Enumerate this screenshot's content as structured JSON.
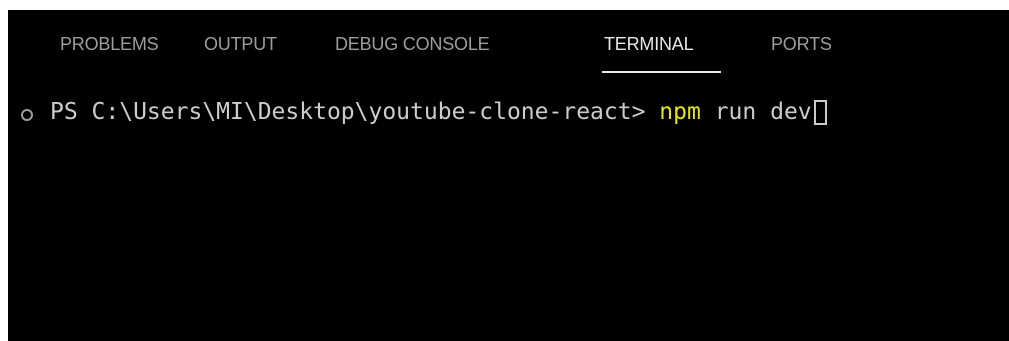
{
  "panel": {
    "tabs": [
      {
        "label": "PROBLEMS",
        "active": false
      },
      {
        "label": "OUTPUT",
        "active": false
      },
      {
        "label": "DEBUG CONSOLE",
        "active": false
      },
      {
        "label": "TERMINAL",
        "active": true
      },
      {
        "label": "PORTS",
        "active": false
      }
    ]
  },
  "terminal": {
    "prompt": "PS C:\\Users\\MI\\Desktop\\youtube-clone-react>",
    "command": "npm",
    "args": "run dev"
  },
  "colors": {
    "background": "#000000",
    "tab_inactive": "#9d9d9d",
    "tab_active": "#e7e7e7",
    "text": "#cccccc",
    "command": "#e5e510"
  }
}
